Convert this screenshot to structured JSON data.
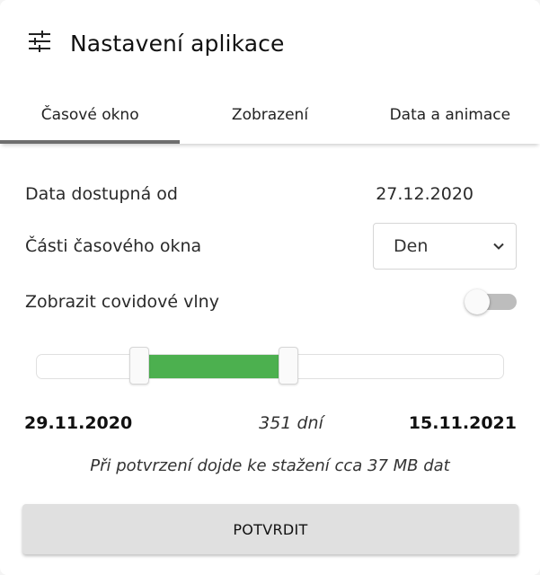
{
  "header": {
    "icon": "tune-sliders-icon",
    "title": "Nastavení aplikace"
  },
  "tabs": [
    {
      "label": "Časové okno",
      "active": true
    },
    {
      "label": "Zobrazení",
      "active": false
    },
    {
      "label": "Data a animace",
      "active": false
    }
  ],
  "settings": {
    "available_from": {
      "label": "Data dostupná od",
      "value": "27.12.2020"
    },
    "window_parts": {
      "label": "Části časového okna",
      "selected": "Den",
      "icon": "chevron-down-icon"
    },
    "covid_waves": {
      "label": "Zobrazit covidové vlny",
      "enabled": false
    }
  },
  "range": {
    "start": "29.11.2020",
    "end": "15.11.2021",
    "days": "351 dní",
    "start_fraction": 0.22,
    "end_fraction": 0.54,
    "fill_color": "#4cb04f"
  },
  "note": "Při potvrzení dojde ke stažení cca 37 MB dat",
  "confirm_label": "POTVRDIT"
}
